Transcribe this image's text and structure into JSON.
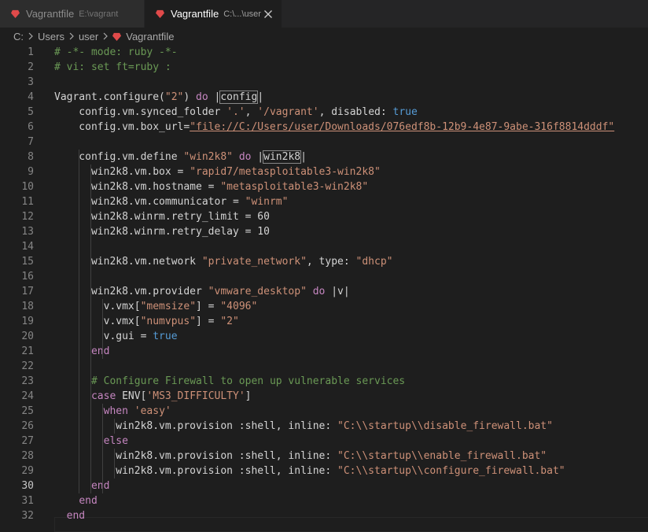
{
  "tabs": [
    {
      "label": "Vagrantfile",
      "path": "E:\\vagrant",
      "active": false
    },
    {
      "label": "Vagrantfile",
      "path": "C:\\...\\user",
      "active": true
    }
  ],
  "breadcrumb": [
    "C:",
    "Users",
    "user",
    "Vagrantfile"
  ],
  "colors": {
    "ruby_icon": "#e04a4a",
    "comment": "#6a9955",
    "string": "#ce9178",
    "keyword": "#569cd6",
    "control": "#c586c0"
  },
  "current_line": 30,
  "lines": [
    {
      "n": "1",
      "t": [
        [
          "c",
          "# -*- mode: ruby -*-"
        ]
      ]
    },
    {
      "n": "2",
      "t": [
        [
          "c",
          "# vi: set ft=ruby :"
        ]
      ]
    },
    {
      "n": "3",
      "t": []
    },
    {
      "n": "4",
      "t": [
        [
          "p",
          "Vagrant.configure("
        ],
        [
          "s",
          "\"2\""
        ],
        [
          "p",
          ") "
        ],
        [
          "kw",
          "do"
        ],
        [
          "p",
          " |"
        ],
        [
          "b",
          "config"
        ],
        [
          "p",
          "|"
        ]
      ]
    },
    {
      "n": "5",
      "t": [
        [
          "p",
          "    config.vm.synced_folder "
        ],
        [
          "s",
          "'.'"
        ],
        [
          "p",
          ", "
        ],
        [
          "s",
          "'/vagrant'"
        ],
        [
          "p",
          ", disabled: "
        ],
        [
          "k",
          "true"
        ]
      ]
    },
    {
      "n": "6",
      "t": [
        [
          "p",
          "    config.vm.box_url="
        ],
        [
          "su",
          "\"file://C:/Users/user/Downloads/076edf8b-12b9-4e87-9abe-316f8814dddf\""
        ]
      ]
    },
    {
      "n": "7",
      "t": []
    },
    {
      "n": "8",
      "t": [
        [
          "p",
          "    config.vm.define "
        ],
        [
          "s",
          "\"win2k8\""
        ],
        [
          "p",
          " "
        ],
        [
          "kw",
          "do"
        ],
        [
          "p",
          " |"
        ],
        [
          "b",
          "win2k8"
        ],
        [
          "p",
          "|"
        ]
      ]
    },
    {
      "n": "9",
      "t": [
        [
          "p",
          "      win2k8.vm.box = "
        ],
        [
          "s",
          "\"rapid7/metasploitable3-win2k8\""
        ]
      ]
    },
    {
      "n": "10",
      "t": [
        [
          "p",
          "      win2k8.vm.hostname = "
        ],
        [
          "s",
          "\"metasploitable3-win2k8\""
        ]
      ]
    },
    {
      "n": "11",
      "t": [
        [
          "p",
          "      win2k8.vm.communicator = "
        ],
        [
          "s",
          "\"winrm\""
        ]
      ]
    },
    {
      "n": "12",
      "t": [
        [
          "p",
          "      win2k8.winrm.retry_limit = 60"
        ]
      ]
    },
    {
      "n": "13",
      "t": [
        [
          "p",
          "      win2k8.winrm.retry_delay = 10"
        ]
      ]
    },
    {
      "n": "14",
      "t": []
    },
    {
      "n": "15",
      "t": [
        [
          "p",
          "      win2k8.vm.network "
        ],
        [
          "s",
          "\"private_network\""
        ],
        [
          "p",
          ", type: "
        ],
        [
          "s",
          "\"dhcp\""
        ]
      ]
    },
    {
      "n": "16",
      "t": []
    },
    {
      "n": "17",
      "t": [
        [
          "p",
          "      win2k8.vm.provider "
        ],
        [
          "s",
          "\"vmware_desktop\""
        ],
        [
          "p",
          " "
        ],
        [
          "kw",
          "do"
        ],
        [
          "p",
          " |"
        ],
        [
          "p",
          "v"
        ],
        [
          "p",
          "|"
        ]
      ]
    },
    {
      "n": "18",
      "t": [
        [
          "p",
          "        v.vmx["
        ],
        [
          "s",
          "\"memsize\""
        ],
        [
          "p",
          "] = "
        ],
        [
          "s",
          "\"4096\""
        ]
      ]
    },
    {
      "n": "19",
      "t": [
        [
          "p",
          "        v.vmx["
        ],
        [
          "s",
          "\"numvpus\""
        ],
        [
          "p",
          "] = "
        ],
        [
          "s",
          "\"2\""
        ]
      ]
    },
    {
      "n": "20",
      "t": [
        [
          "p",
          "        v.gui = "
        ],
        [
          "k",
          "true"
        ]
      ]
    },
    {
      "n": "21",
      "t": [
        [
          "p",
          "      "
        ],
        [
          "kw",
          "end"
        ]
      ]
    },
    {
      "n": "22",
      "t": []
    },
    {
      "n": "23",
      "t": [
        [
          "p",
          "      "
        ],
        [
          "c",
          "# Configure Firewall to open up vulnerable services"
        ]
      ]
    },
    {
      "n": "24",
      "t": [
        [
          "p",
          "      "
        ],
        [
          "kw",
          "case"
        ],
        [
          "p",
          " ENV["
        ],
        [
          "s",
          "'MS3_DIFFICULTY'"
        ],
        [
          "p",
          "]"
        ]
      ]
    },
    {
      "n": "25",
      "t": [
        [
          "p",
          "        "
        ],
        [
          "kw",
          "when"
        ],
        [
          "p",
          " "
        ],
        [
          "s",
          "'easy'"
        ]
      ]
    },
    {
      "n": "26",
      "t": [
        [
          "p",
          "          win2k8.vm.provision :shell, inline: "
        ],
        [
          "s",
          "\"C:\\\\startup\\\\disable_firewall.bat\""
        ]
      ]
    },
    {
      "n": "27",
      "t": [
        [
          "p",
          "        "
        ],
        [
          "kw",
          "else"
        ]
      ]
    },
    {
      "n": "28",
      "t": [
        [
          "p",
          "          win2k8.vm.provision :shell, inline: "
        ],
        [
          "s",
          "\"C:\\\\startup\\\\enable_firewall.bat\""
        ]
      ]
    },
    {
      "n": "29",
      "t": [
        [
          "p",
          "          win2k8.vm.provision :shell, inline: "
        ],
        [
          "s",
          "\"C:\\\\startup\\\\configure_firewall.bat\""
        ]
      ]
    },
    {
      "n": "30",
      "t": [
        [
          "p",
          "      "
        ],
        [
          "kw",
          "end"
        ]
      ]
    },
    {
      "n": "31",
      "t": [
        [
          "p",
          "    "
        ],
        [
          "kw",
          "end"
        ]
      ]
    },
    {
      "n": "32",
      "t": [
        [
          "p",
          "  "
        ],
        [
          "kw",
          "end"
        ]
      ]
    }
  ]
}
